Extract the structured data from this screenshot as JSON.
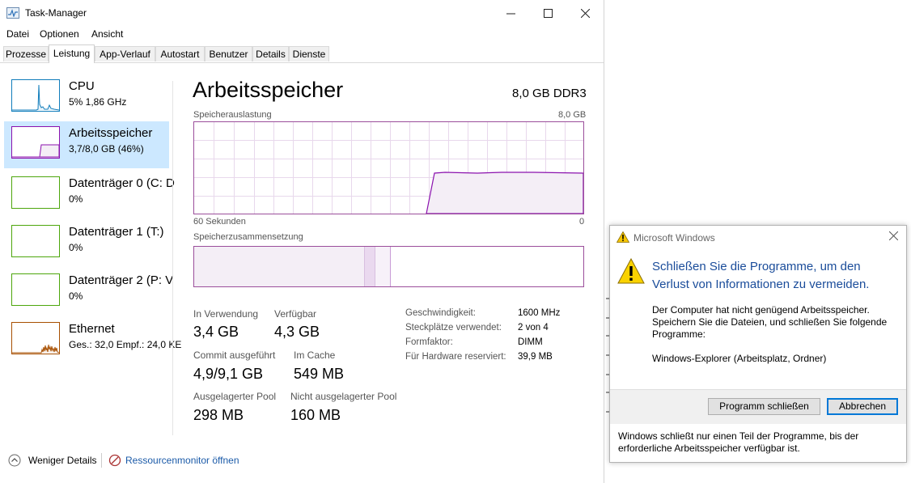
{
  "window": {
    "title": "Task-Manager",
    "controls": {
      "minimize": "—",
      "maximize": "☐",
      "close": "✕"
    }
  },
  "menu": [
    "Datei",
    "Optionen",
    "Ansicht"
  ],
  "tabs": [
    {
      "label": "Prozesse",
      "active": false
    },
    {
      "label": "Leistung",
      "active": true
    },
    {
      "label": "App-Verlauf",
      "active": false
    },
    {
      "label": "Autostart",
      "active": false
    },
    {
      "label": "Benutzer",
      "active": false
    },
    {
      "label": "Details",
      "active": false
    },
    {
      "label": "Dienste",
      "active": false
    }
  ],
  "sidebar": {
    "items": [
      {
        "name": "CPU",
        "sub": "5% 1,86 GHz",
        "color": "#117dbb",
        "active": false
      },
      {
        "name": "Arbeitsspeicher",
        "sub": "3,7/8,0 GB (46%)",
        "color": "#8b12ae",
        "active": true
      },
      {
        "name": "Datenträger 0 (C: D",
        "sub": "0%",
        "color": "#4da60c",
        "active": false
      },
      {
        "name": "Datenträger 1 (T:)",
        "sub": "0%",
        "color": "#4da60c",
        "active": false
      },
      {
        "name": "Datenträger 2 (P: V",
        "sub": "0%",
        "color": "#4da60c",
        "active": false
      },
      {
        "name": "Ethernet",
        "sub": "Ges.: 32,0 Empf.: 24,0 KE",
        "color": "#a74f01",
        "active": false
      }
    ]
  },
  "main": {
    "title": "Arbeitsspeicher",
    "capacity": "8,0 GB DDR3",
    "usage_graph": {
      "label": "Speicherauslastung",
      "max_label": "8,0 GB",
      "time_left": "60 Sekunden",
      "time_right": "0"
    },
    "composition": {
      "label": "Speicherzusammensetzung"
    },
    "stats": {
      "in_use": {
        "label": "In Verwendung",
        "value": "3,4 GB"
      },
      "available": {
        "label": "Verfügbar",
        "value": "4,3 GB"
      },
      "committed": {
        "label": "Commit ausgeführt",
        "value": "4,9/9,1 GB"
      },
      "cached": {
        "label": "Im Cache",
        "value": "549 MB"
      },
      "paged_pool": {
        "label": "Ausgelagerter Pool",
        "value": "298 MB"
      },
      "nonpaged_pool": {
        "label": "Nicht ausgelagerter Pool",
        "value": "160 MB"
      }
    },
    "details": [
      {
        "key": "Geschwindigkeit:",
        "value": "1600 MHz"
      },
      {
        "key": "Steckplätze verwendet:",
        "value": "2 von 4"
      },
      {
        "key": "Formfaktor:",
        "value": "DIMM"
      },
      {
        "key": "Für Hardware reserviert:",
        "value": "39,9 MB"
      }
    ]
  },
  "footer": {
    "less_details": "Weniger Details",
    "resource_monitor": "Ressourcenmonitor öffnen"
  },
  "dialog": {
    "title": "Microsoft Windows",
    "heading": "Schließen Sie die Programme, um den Verlust von Informationen zu vermeiden.",
    "body": "Der Computer hat nicht genügend Arbeitsspeicher. Speichern Sie die Dateien, und schließen Sie folgende Programme:",
    "program": "Windows-Explorer (Arbeitsplatz, Ordner)",
    "btn_close": "Programm schließen",
    "btn_cancel": "Abbrechen",
    "note": "Windows schließt nur einen Teil der Programme, bis der erforderliche Arbeitsspeicher verfügbar ist."
  },
  "colors": {
    "memory": "#8b12ae",
    "memory_fill": "#f4eef6",
    "link": "#1a5aa8",
    "selection": "#cce8ff"
  }
}
